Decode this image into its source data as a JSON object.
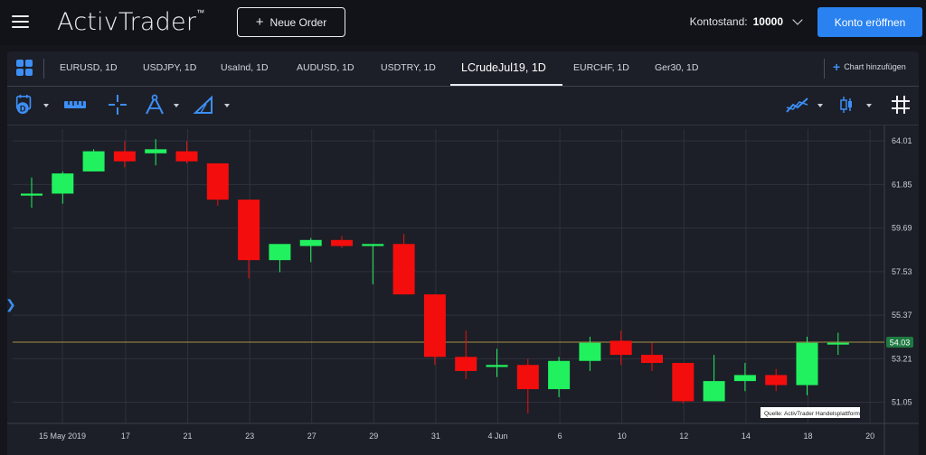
{
  "header": {
    "logo_text": "ActivTrader",
    "logo_tm": "™",
    "new_order_label": "Neue Order",
    "balance_label": "Kontostand:",
    "balance_value": "10000",
    "open_account_label": "Konto eröffnen"
  },
  "tabs": [
    {
      "label": "EURUSD, 1D"
    },
    {
      "label": "USDJPY, 1D"
    },
    {
      "label": "UsaInd, 1D"
    },
    {
      "label": "AUDUSD, 1D"
    },
    {
      "label": "USDTRY, 1D"
    },
    {
      "label": "LCrudeJul19, 1D",
      "active": true
    },
    {
      "label": "EURCHF, 1D"
    },
    {
      "label": "Ger30, 1D"
    }
  ],
  "add_chart_label": "Chart hinzufügen",
  "toolbar": {
    "icons": [
      "calendar-icon",
      "ruler-icon",
      "crosshair-icon",
      "compass-icon",
      "triangle-icon",
      "indicators-icon",
      "candles-icon",
      "grid-icon"
    ],
    "calendar_letter": "D"
  },
  "colors": {
    "up": "#21f15f",
    "down": "#f40d0d",
    "accent": "#2a82f0",
    "current_line": "#a89045",
    "price_tag": "#1f7a42"
  },
  "chart_data": {
    "type": "candlestick",
    "symbol": "LCrudeJul19",
    "timeframe": "1D",
    "x_labels": [
      "15 May 2019",
      "17",
      "21",
      "23",
      "27",
      "29",
      "31",
      "4 Jun",
      "6",
      "10",
      "12",
      "14",
      "18",
      "20"
    ],
    "y_ticks": [
      "64.01",
      "61.85",
      "59.69",
      "57.53",
      "55.37",
      "53.21",
      "51.05"
    ],
    "ylim": [
      50.0,
      64.6
    ],
    "current_price": "54.03",
    "source_label": "Quelle: ActivTrader Handelsplattform",
    "candles": [
      {
        "o": 61.3,
        "h": 62.2,
        "l": 60.7,
        "c": 61.4
      },
      {
        "o": 61.4,
        "h": 62.5,
        "l": 60.9,
        "c": 62.4
      },
      {
        "o": 62.5,
        "h": 63.6,
        "l": 62.5,
        "c": 63.5
      },
      {
        "o": 63.5,
        "h": 64.0,
        "l": 62.7,
        "c": 63.0
      },
      {
        "o": 63.4,
        "h": 64.1,
        "l": 62.8,
        "c": 63.6
      },
      {
        "o": 63.5,
        "h": 64.0,
        "l": 62.9,
        "c": 63.0
      },
      {
        "o": 62.9,
        "h": 62.9,
        "l": 60.8,
        "c": 61.1
      },
      {
        "o": 61.1,
        "h": 61.1,
        "l": 57.2,
        "c": 58.1
      },
      {
        "o": 58.1,
        "h": 58.7,
        "l": 57.5,
        "c": 58.9
      },
      {
        "o": 58.8,
        "h": 59.2,
        "l": 58.0,
        "c": 59.1
      },
      {
        "o": 59.1,
        "h": 59.3,
        "l": 58.7,
        "c": 58.8
      },
      {
        "o": 58.8,
        "h": 58.9,
        "l": 56.9,
        "c": 58.9
      },
      {
        "o": 58.9,
        "h": 59.4,
        "l": 56.5,
        "c": 56.4
      },
      {
        "o": 56.4,
        "h": 56.4,
        "l": 52.9,
        "c": 53.3
      },
      {
        "o": 53.3,
        "h": 54.6,
        "l": 52.2,
        "c": 52.6
      },
      {
        "o": 52.8,
        "h": 53.7,
        "l": 52.3,
        "c": 52.9
      },
      {
        "o": 52.9,
        "h": 53.2,
        "l": 50.5,
        "c": 51.7
      },
      {
        "o": 51.7,
        "h": 53.3,
        "l": 51.3,
        "c": 53.1
      },
      {
        "o": 53.1,
        "h": 54.3,
        "l": 52.6,
        "c": 54.0
      },
      {
        "o": 54.1,
        "h": 54.6,
        "l": 52.9,
        "c": 53.4
      },
      {
        "o": 53.4,
        "h": 54.0,
        "l": 52.6,
        "c": 53.0
      },
      {
        "o": 53.0,
        "h": 53.0,
        "l": 51.0,
        "c": 51.1
      },
      {
        "o": 51.1,
        "h": 53.4,
        "l": 51.1,
        "c": 52.1
      },
      {
        "o": 52.1,
        "h": 53.0,
        "l": 51.6,
        "c": 52.4
      },
      {
        "o": 52.4,
        "h": 52.7,
        "l": 51.6,
        "c": 51.9
      },
      {
        "o": 51.9,
        "h": 54.3,
        "l": 51.4,
        "c": 54.0
      },
      {
        "o": 54.0,
        "h": 54.5,
        "l": 53.4,
        "c": 54.0
      }
    ]
  }
}
